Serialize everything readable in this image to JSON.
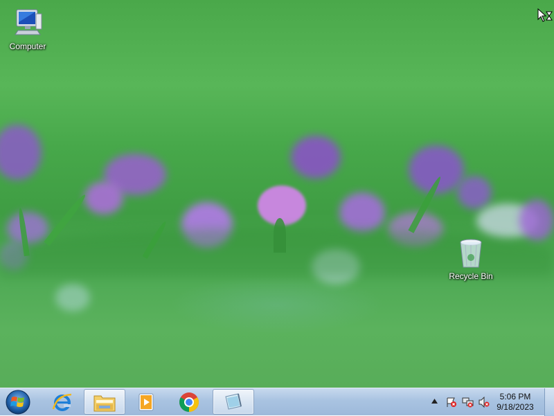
{
  "desktop": {
    "icons": [
      {
        "label": "Computer",
        "icon": "computer-icon"
      },
      {
        "label": "Recycle Bin",
        "icon": "recycle-bin-icon"
      }
    ],
    "wallpaper": "green-meadow-with-purple-clover"
  },
  "taskbar": {
    "start_icon": "windows-logo-icon",
    "items": [
      {
        "name": "Internet Explorer",
        "icon": "internet-explorer-icon",
        "active": false
      },
      {
        "name": "Windows Explorer",
        "icon": "folder-icon",
        "active": true
      },
      {
        "name": "Windows Media Player",
        "icon": "media-player-icon",
        "active": false
      },
      {
        "name": "Google Chrome",
        "icon": "chrome-icon",
        "active": false
      },
      {
        "name": "Notepad",
        "icon": "notepad-icon",
        "active": true
      }
    ],
    "tray": {
      "show_hidden_icon": "triangle-up-icon",
      "clock_time": "5:06 PM",
      "clock_date": "9/18/2023"
    }
  },
  "colors": {
    "taskbar": "#a9c3e1",
    "wallpaper_green": "#4aa84a",
    "flower_purple": "#9a5fd0"
  }
}
